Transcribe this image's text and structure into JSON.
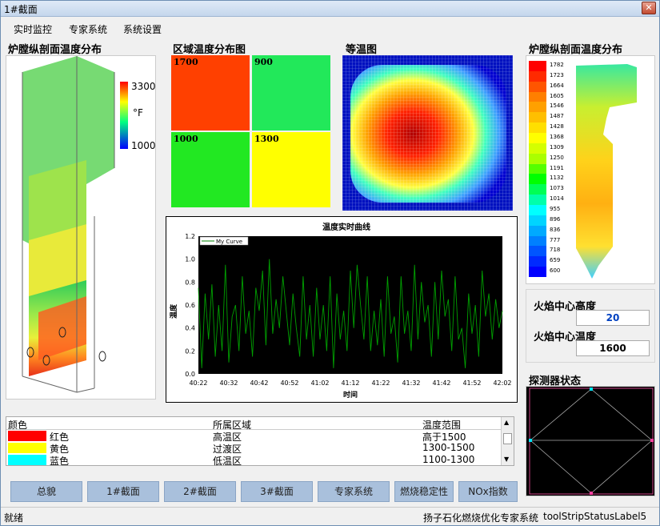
{
  "window": {
    "title": "1#截面",
    "close": "✕"
  },
  "menu": [
    "实时监控",
    "专家系统",
    "系统设置"
  ],
  "sections": {
    "furnace_left": "炉膛纵剖面温度分布",
    "zone": "区域温度分布图",
    "isotherm": "等温图",
    "furnace_right": "炉膛纵剖面温度分布",
    "detector": "探测器状态"
  },
  "furnace_scale": {
    "max": "3300",
    "unit": "°F",
    "min": "1000"
  },
  "zones": [
    {
      "value": "1700",
      "color": "#ff4000"
    },
    {
      "value": "900",
      "color": "#22e85a"
    },
    {
      "value": "1000",
      "color": "#22e822"
    },
    {
      "value": "1300",
      "color": "#ffff00"
    }
  ],
  "right_scale": [
    "1782",
    "1723",
    "1664",
    "1605",
    "1546",
    "1487",
    "1428",
    "1368",
    "1309",
    "1250",
    "1191",
    "1132",
    "1073",
    "1014",
    "955",
    "896",
    "836",
    "777",
    "718",
    "659",
    "600"
  ],
  "flame": {
    "height_label": "火焰中心高度",
    "height_value": "20",
    "temp_label": "火焰中心温度",
    "temp_value": "1600"
  },
  "chart_data": {
    "type": "line",
    "title": "温度实时曲线",
    "xlabel": "时间",
    "ylabel": "温度",
    "legend": "My Curve",
    "ylim": [
      0,
      1.2
    ],
    "yticks": [
      "0.0",
      "0.2",
      "0.4",
      "0.6",
      "0.8",
      "1.0",
      "1.2"
    ],
    "xticks": [
      "40:22",
      "40:32",
      "40:42",
      "40:52",
      "41:02",
      "41:12",
      "41:22",
      "41:32",
      "41:42",
      "41:52",
      "42:02"
    ],
    "series": [
      {
        "name": "My Curve",
        "values": [
          0.75,
          0.05,
          0.7,
          0.3,
          0.78,
          0.15,
          0.6,
          0.2,
          0.95,
          0.1,
          0.5,
          0.6,
          0.2,
          0.85,
          0.35,
          0.55,
          0.15,
          0.75,
          0.55,
          0.9,
          0.25,
          1.0,
          0.35,
          0.65,
          0.4,
          0.85,
          0.55,
          0.25,
          0.7,
          0.4,
          0.15,
          0.85,
          0.3,
          0.6,
          0.15,
          0.75,
          0.3,
          0.6,
          0.2,
          0.85,
          0.05,
          0.7,
          0.3,
          0.55,
          0.2,
          0.9,
          0.4,
          0.95,
          0.6,
          0.3,
          0.85,
          0.2,
          0.55,
          0.25,
          0.65,
          0.15,
          0.85,
          0.35,
          0.5,
          0.1,
          0.85,
          0.35,
          0.55,
          0.2,
          0.95,
          0.3,
          0.8,
          0.45,
          0.6,
          0.15,
          0.8,
          0.3,
          0.9,
          0.5,
          0.65,
          0.2,
          0.85,
          0.3,
          0.4,
          0.05,
          0.7,
          0.35,
          0.6,
          0.15,
          0.9,
          0.5,
          0.7,
          0.3,
          0.65,
          0.4,
          0.55
        ]
      }
    ]
  },
  "legend_table": {
    "headers": [
      "颜色",
      "所属区域",
      "温度范围"
    ],
    "rows": [
      {
        "color": "#ff0000",
        "name": "红色",
        "zone": "高温区",
        "range": "高于1500"
      },
      {
        "color": "#ffff00",
        "name": "黄色",
        "zone": "过渡区",
        "range": "1300-1500"
      },
      {
        "color": "#00ffff",
        "name": "蓝色",
        "zone": "低温区",
        "range": "1100-1300"
      }
    ]
  },
  "buttons": [
    "总貌",
    "1#截面",
    "2#截面",
    "3#截面",
    "专家系统",
    "燃烧稳定性",
    "NOx指数"
  ],
  "status": {
    "left": "就绪",
    "app": "扬子石化燃烧优化专家系统",
    "label5": "toolStripStatusLabel5"
  }
}
